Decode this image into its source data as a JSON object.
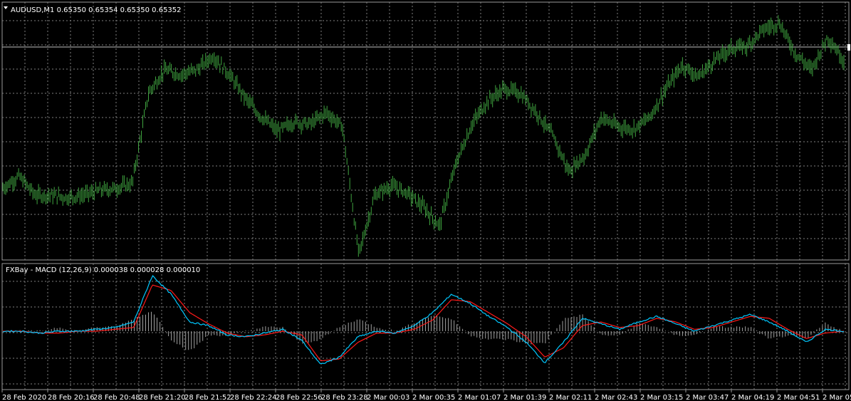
{
  "main_panel": {
    "symbol_header": "AUDUSD,M1  0.65350 0.65354 0.65350 0.65352",
    "menu_icon": "triangle-down-icon"
  },
  "indicator_panel": {
    "header": "FXBay - MACD (12,26,9) 0.000038 0.000028 0.000010"
  },
  "time_axis": {
    "labels": [
      "28 Feb 2020",
      "28 Feb 20:16",
      "28 Feb 20:48",
      "28 Feb 21:20",
      "28 Feb 21:52",
      "28 Feb 22:24",
      "28 Feb 22:56",
      "28 Feb 23:28",
      "2 Mar 00:03",
      "2 Mar 00:35",
      "2 Mar 01:07",
      "2 Mar 01:39",
      "2 Mar 02:11",
      "2 Mar 02:43",
      "2 Mar 03:15",
      "2 Mar 03:47",
      "2 Mar 04:19",
      "2 Mar 04:51",
      "2 Mar 05:"
    ]
  },
  "colors": {
    "background": "#000000",
    "grid": "#7f7f7f",
    "price_bars": "#3fa33f",
    "macd_main": "#00c8ff",
    "macd_signal": "#ff1a1a",
    "histogram": "#bdbdbd",
    "border": "#9a9a9a",
    "text": "#ffffff",
    "current_price_line": "#bfbfbf"
  },
  "chart_data": [
    {
      "type": "line",
      "series_style": "ohlc-bars",
      "x": [
        "28 Feb 2020",
        "28 Feb 20:16",
        "28 Feb 20:48",
        "28 Feb 21:20",
        "28 Feb 21:52",
        "28 Feb 22:24",
        "28 Feb 22:56",
        "28 Feb 23:28",
        "2 Mar 00:03",
        "2 Mar 00:35",
        "2 Mar 01:07",
        "2 Mar 01:39",
        "2 Mar 02:11",
        "2 Mar 02:43",
        "2 Mar 03:15",
        "2 Mar 03:47",
        "2 Mar 04:19",
        "2 Mar 04:51",
        "2 Mar 05:"
      ],
      "value_profile": [
        0.28,
        0.33,
        0.25,
        0.25,
        0.24,
        0.25,
        0.27,
        0.28,
        0.3,
        0.68,
        0.78,
        0.76,
        0.78,
        0.84,
        0.76,
        0.66,
        0.58,
        0.52,
        0.56,
        0.55,
        0.6,
        0.54,
        0.0,
        0.25,
        0.29,
        0.26,
        0.2,
        0.12,
        0.38,
        0.55,
        0.65,
        0.7,
        0.68,
        0.6,
        0.5,
        0.35,
        0.42,
        0.58,
        0.54,
        0.53,
        0.58,
        0.7,
        0.8,
        0.75,
        0.82,
        0.87,
        0.88,
        0.95,
        0.98,
        0.85,
        0.78,
        0.92,
        0.82
      ],
      "grid": true
    },
    {
      "type": "line",
      "series": [
        {
          "name": "main",
          "profile": [
            0.0,
            0.0,
            -0.1,
            0.0,
            0.0,
            0.1,
            0.2,
            0.5,
            3.0,
            2.0,
            0.5,
            0.3,
            -0.2,
            -0.3,
            -0.1,
            0.1,
            -0.5,
            -1.8,
            -1.4,
            -0.3,
            0.0,
            -0.1,
            0.3,
            1.0,
            2.0,
            1.5,
            0.8,
            0.2,
            -0.6,
            -1.7,
            -0.6,
            0.7,
            0.4,
            0.1,
            0.5,
            0.8,
            0.4,
            0.0,
            0.3,
            0.6,
            0.9,
            0.5,
            0.0,
            -0.6,
            0.1,
            0.0
          ]
        },
        {
          "name": "signal",
          "profile": [
            0.0,
            0.0,
            -0.1,
            -0.1,
            0.0,
            0.0,
            0.1,
            0.2,
            2.5,
            2.2,
            1.0,
            0.4,
            -0.1,
            -0.3,
            -0.2,
            0.0,
            -0.2,
            -1.6,
            -1.5,
            -0.6,
            -0.1,
            -0.1,
            0.1,
            0.6,
            1.7,
            1.6,
            1.0,
            0.4,
            -0.3,
            -1.4,
            -0.9,
            0.3,
            0.5,
            0.2,
            0.3,
            0.7,
            0.5,
            0.1,
            0.2,
            0.5,
            0.8,
            0.7,
            0.1,
            -0.4,
            -0.1,
            0.0
          ]
        }
      ],
      "histogram": true,
      "grid": true
    }
  ]
}
